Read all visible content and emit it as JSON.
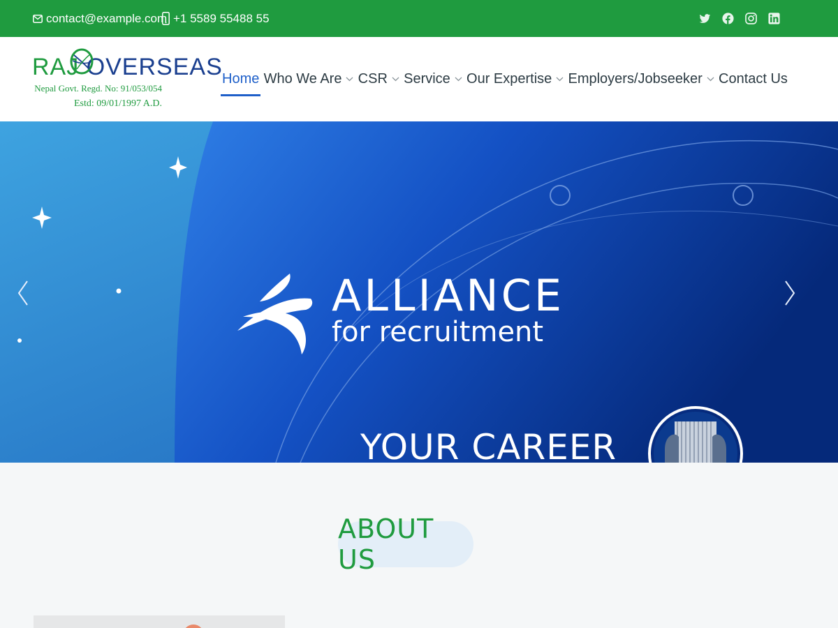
{
  "topbar": {
    "email": "contact@example.com",
    "phone": "+1 5589 55488 55",
    "social_icons": [
      "twitter-icon",
      "facebook-icon",
      "instagram-icon",
      "linkedin-icon"
    ]
  },
  "logo": {
    "brand_part1": "RAJ ",
    "brand_part2": "OVERSEAS",
    "regd": "Nepal Govt. Regd. No: 91/053/054",
    "estd": "Estd: 09/01/1997 A.D."
  },
  "nav": {
    "items": [
      {
        "label": "Home",
        "dropdown": false,
        "active": true
      },
      {
        "label": "Who We Are",
        "dropdown": true
      },
      {
        "label": "CSR",
        "dropdown": true
      },
      {
        "label": "Service",
        "dropdown": true
      },
      {
        "label": "Our Expertise",
        "dropdown": true
      },
      {
        "label": "Employers/Jobseeker",
        "dropdown": true
      },
      {
        "label": "Contact Us",
        "dropdown": false
      }
    ]
  },
  "hero": {
    "title": "ALLIANCE",
    "subtitle": "for recruitment",
    "tagline": "YOUR CAREER"
  },
  "about": {
    "heading": "ABOUT US"
  },
  "colors": {
    "brand_green": "#1f9b3f",
    "brand_blue": "#1a3f8f",
    "nav_active": "#1e5fc9",
    "hero_dark": "#06307a"
  }
}
